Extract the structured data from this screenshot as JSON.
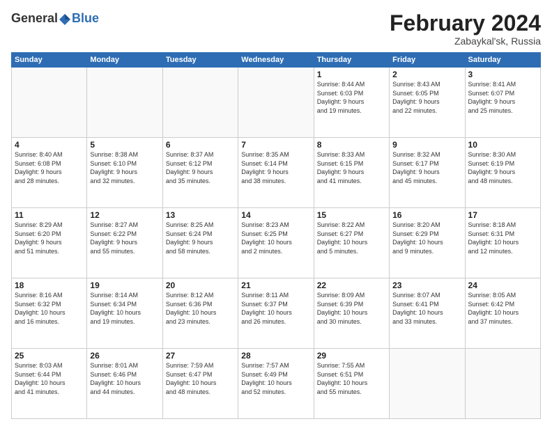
{
  "header": {
    "logo_general": "General",
    "logo_blue": "Blue",
    "month_title": "February 2024",
    "location": "Zabaykal'sk, Russia"
  },
  "days_of_week": [
    "Sunday",
    "Monday",
    "Tuesday",
    "Wednesday",
    "Thursday",
    "Friday",
    "Saturday"
  ],
  "weeks": [
    [
      {
        "day": "",
        "info": ""
      },
      {
        "day": "",
        "info": ""
      },
      {
        "day": "",
        "info": ""
      },
      {
        "day": "",
        "info": ""
      },
      {
        "day": "1",
        "info": "Sunrise: 8:44 AM\nSunset: 6:03 PM\nDaylight: 9 hours\nand 19 minutes."
      },
      {
        "day": "2",
        "info": "Sunrise: 8:43 AM\nSunset: 6:05 PM\nDaylight: 9 hours\nand 22 minutes."
      },
      {
        "day": "3",
        "info": "Sunrise: 8:41 AM\nSunset: 6:07 PM\nDaylight: 9 hours\nand 25 minutes."
      }
    ],
    [
      {
        "day": "4",
        "info": "Sunrise: 8:40 AM\nSunset: 6:08 PM\nDaylight: 9 hours\nand 28 minutes."
      },
      {
        "day": "5",
        "info": "Sunrise: 8:38 AM\nSunset: 6:10 PM\nDaylight: 9 hours\nand 32 minutes."
      },
      {
        "day": "6",
        "info": "Sunrise: 8:37 AM\nSunset: 6:12 PM\nDaylight: 9 hours\nand 35 minutes."
      },
      {
        "day": "7",
        "info": "Sunrise: 8:35 AM\nSunset: 6:14 PM\nDaylight: 9 hours\nand 38 minutes."
      },
      {
        "day": "8",
        "info": "Sunrise: 8:33 AM\nSunset: 6:15 PM\nDaylight: 9 hours\nand 41 minutes."
      },
      {
        "day": "9",
        "info": "Sunrise: 8:32 AM\nSunset: 6:17 PM\nDaylight: 9 hours\nand 45 minutes."
      },
      {
        "day": "10",
        "info": "Sunrise: 8:30 AM\nSunset: 6:19 PM\nDaylight: 9 hours\nand 48 minutes."
      }
    ],
    [
      {
        "day": "11",
        "info": "Sunrise: 8:29 AM\nSunset: 6:20 PM\nDaylight: 9 hours\nand 51 minutes."
      },
      {
        "day": "12",
        "info": "Sunrise: 8:27 AM\nSunset: 6:22 PM\nDaylight: 9 hours\nand 55 minutes."
      },
      {
        "day": "13",
        "info": "Sunrise: 8:25 AM\nSunset: 6:24 PM\nDaylight: 9 hours\nand 58 minutes."
      },
      {
        "day": "14",
        "info": "Sunrise: 8:23 AM\nSunset: 6:25 PM\nDaylight: 10 hours\nand 2 minutes."
      },
      {
        "day": "15",
        "info": "Sunrise: 8:22 AM\nSunset: 6:27 PM\nDaylight: 10 hours\nand 5 minutes."
      },
      {
        "day": "16",
        "info": "Sunrise: 8:20 AM\nSunset: 6:29 PM\nDaylight: 10 hours\nand 9 minutes."
      },
      {
        "day": "17",
        "info": "Sunrise: 8:18 AM\nSunset: 6:31 PM\nDaylight: 10 hours\nand 12 minutes."
      }
    ],
    [
      {
        "day": "18",
        "info": "Sunrise: 8:16 AM\nSunset: 6:32 PM\nDaylight: 10 hours\nand 16 minutes."
      },
      {
        "day": "19",
        "info": "Sunrise: 8:14 AM\nSunset: 6:34 PM\nDaylight: 10 hours\nand 19 minutes."
      },
      {
        "day": "20",
        "info": "Sunrise: 8:12 AM\nSunset: 6:36 PM\nDaylight: 10 hours\nand 23 minutes."
      },
      {
        "day": "21",
        "info": "Sunrise: 8:11 AM\nSunset: 6:37 PM\nDaylight: 10 hours\nand 26 minutes."
      },
      {
        "day": "22",
        "info": "Sunrise: 8:09 AM\nSunset: 6:39 PM\nDaylight: 10 hours\nand 30 minutes."
      },
      {
        "day": "23",
        "info": "Sunrise: 8:07 AM\nSunset: 6:41 PM\nDaylight: 10 hours\nand 33 minutes."
      },
      {
        "day": "24",
        "info": "Sunrise: 8:05 AM\nSunset: 6:42 PM\nDaylight: 10 hours\nand 37 minutes."
      }
    ],
    [
      {
        "day": "25",
        "info": "Sunrise: 8:03 AM\nSunset: 6:44 PM\nDaylight: 10 hours\nand 41 minutes."
      },
      {
        "day": "26",
        "info": "Sunrise: 8:01 AM\nSunset: 6:46 PM\nDaylight: 10 hours\nand 44 minutes."
      },
      {
        "day": "27",
        "info": "Sunrise: 7:59 AM\nSunset: 6:47 PM\nDaylight: 10 hours\nand 48 minutes."
      },
      {
        "day": "28",
        "info": "Sunrise: 7:57 AM\nSunset: 6:49 PM\nDaylight: 10 hours\nand 52 minutes."
      },
      {
        "day": "29",
        "info": "Sunrise: 7:55 AM\nSunset: 6:51 PM\nDaylight: 10 hours\nand 55 minutes."
      },
      {
        "day": "",
        "info": ""
      },
      {
        "day": "",
        "info": ""
      }
    ]
  ]
}
